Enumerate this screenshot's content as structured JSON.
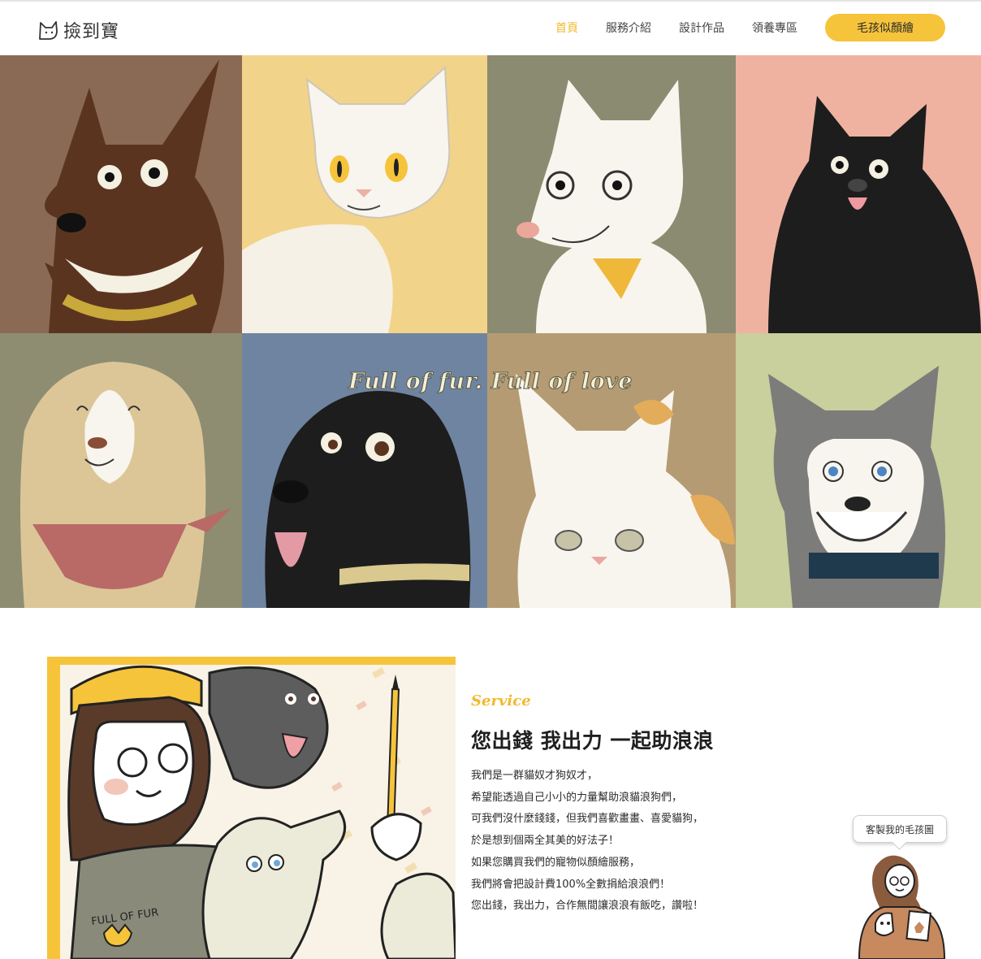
{
  "header": {
    "logo_text": "撿到寶",
    "nav": [
      {
        "label": "首頁",
        "active": true
      },
      {
        "label": "服務介紹",
        "active": false
      },
      {
        "label": "設計作品",
        "active": false
      },
      {
        "label": "領養專區",
        "active": false
      }
    ],
    "cta_label": "毛孩似顏繪"
  },
  "hero": {
    "tagline": "Full of fur. Full of love",
    "tiles": [
      {
        "subject": "brown-dog-icon",
        "bg": "#8b6a55"
      },
      {
        "subject": "white-cat-icon",
        "bg": "#f2d38a"
      },
      {
        "subject": "white-dog-icon",
        "bg": "#8b8b71"
      },
      {
        "subject": "black-dog-icon",
        "bg": "#efb2a1"
      },
      {
        "subject": "golden-dog-icon",
        "bg": "#8e8d71"
      },
      {
        "subject": "black-lab-icon",
        "bg": "#6f84a0"
      },
      {
        "subject": "calico-cat-icon",
        "bg": "#b59b73"
      },
      {
        "subject": "husky-icon",
        "bg": "#c9cf9d"
      }
    ]
  },
  "service": {
    "eyebrow": "Service",
    "title": "您出錢 我出力 一起助浪浪",
    "paragraphs": [
      "我們是一群貓奴才狗奴才，",
      "希望能透過自己小小的力量幫助浪貓浪狗們，",
      "可我們沒什麼錢錢，但我們喜歡畫畫、喜愛貓狗，",
      "於是想到個兩全其美的好法子！",
      "如果您購買我們的寵物似顏繪服務，",
      "我們將會把設計費100%全數捐給浪浪們！",
      "您出錢，我出力，合作無間讓浪浪有飯吃，讚啦！"
    ],
    "illustration_text": "FULL OF FUR"
  },
  "widget": {
    "bubble_label": "客製我的毛孩圖"
  },
  "colors": {
    "accent": "#f6c43b",
    "nav_active": "#f2b92d"
  }
}
